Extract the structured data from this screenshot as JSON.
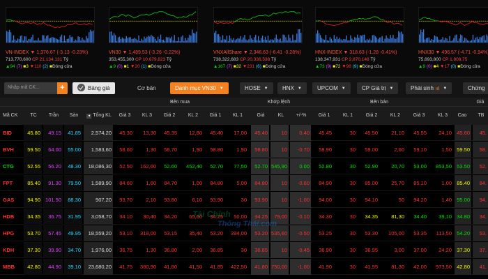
{
  "indices": [
    {
      "name": "VN-INDEX",
      "value": "1,376.67",
      "change": "(-3.13 -0.23%)",
      "vol": "713,770,600",
      "cp": "CP 21,134,131",
      "unit": "Tỷ",
      "up": "94",
      "ref": "(7)",
      "dn": "110",
      "ceil": "(2)",
      "floor": "3",
      "status": "Đóng cửa"
    },
    {
      "name": "VN30",
      "value": "1,489.53",
      "change": "(-3.26 -0.22%)",
      "vol": "353,455,300",
      "cp": "CP 10,679,823",
      "unit": "Tỷ",
      "up": "9",
      "ref": "(0)",
      "dn": "20",
      "ceil": "(1)",
      "floor": "1",
      "status": "Đóng cửa"
    },
    {
      "name": "VNXAllShare",
      "value": "2,346.63",
      "change": "(-6.41 -0.28%)",
      "vol": "738,322,683",
      "cp": "CP 20,336,538",
      "unit": "Tỷ",
      "up": "167",
      "ref": "(7)",
      "dn": "231",
      "ceil": "(6)",
      "floor": "32",
      "status": "Đóng cửa"
    },
    {
      "name": "HNX-INDEX",
      "value": "318.63",
      "change": "(-1.28 -0.41%)",
      "vol": "138,347,931",
      "cp": "CP 2,870,148",
      "unit": "Tỷ",
      "up": "73",
      "ref": "(9)",
      "dn": "98",
      "ceil": "(9)",
      "floor": "72",
      "status": "Đóng cửa"
    },
    {
      "name": "HNX30",
      "value": "496.57",
      "change": "(-4.71 -0.94%)",
      "vol": "75,693,800",
      "cp": "CP 1,808,75",
      "unit": "",
      "up": "9",
      "ref": "(0)",
      "dn": "17",
      "ceil": "(0)",
      "floor": "4",
      "status": "Đóng cửa"
    }
  ],
  "toolbar": {
    "search_placeholder": "Nhập mã CK...",
    "search_btn": "+",
    "bang_gia": "Bảng giá",
    "co_ban": "Cơ bản",
    "danh_muc": "Danh mục VN30",
    "hose": "HOSE",
    "hnx": "HNX",
    "upcom": "UPCOM",
    "cp_gia_tri": "CP Giá trị",
    "phai_sinh": "Phái sinh",
    "chung": "Chứng"
  },
  "headers": {
    "group_buy": "Bên mua",
    "group_match": "Khớp lệnh",
    "group_sell": "Bên bán",
    "group_more": "Giá",
    "ma_ck": "Mã CK",
    "tc": "TC",
    "tran": "Trần",
    "san": "Sàn",
    "tong_kl": "Tổng KL",
    "gia3": "Giá 3",
    "kl3": "KL 3",
    "gia2": "Giá 2",
    "kl2": "KL 2",
    "gia1": "Giá 1",
    "kl1": "KL 1",
    "gia": "Giá",
    "kl": "KL",
    "pm": "+/-%",
    "sgia1": "Giá 1",
    "skl1": "KL 1",
    "sgia2": "Giá 2",
    "skl2": "KL 2",
    "sgia3": "Giá 3",
    "skl3": "KL 3",
    "cao": "Cao",
    "tb": "TB"
  },
  "rows": [
    {
      "sym": "BID",
      "tc": "45.80",
      "tran": "49.15",
      "san": "41.85",
      "tong": "2,574,20",
      "b3": "45.30",
      "bk3": "13,30",
      "b2": "45.35",
      "bk2": "12,80",
      "b1": "45.40",
      "bk1": "17,00",
      "m": "45.40",
      "mk": "10",
      "pm": "0.40",
      "s1": "45.45",
      "sk1": "30",
      "s2": "45.50",
      "sk2": "21,10",
      "s3": "45.55",
      "sk3": "24,10",
      "cao": "45.60",
      "tb": "45."
    },
    {
      "sym": "BVH",
      "tc": "59.50",
      "tran": "64.00",
      "san": "55.00",
      "tong": "1,583,60",
      "b3": "58.60",
      "bk3": "1,30",
      "b2": "58.70",
      "bk2": "1,90",
      "b1": "58.80",
      "bk1": "1,90",
      "m": "58.80",
      "mk": "10",
      "pm": "-0.70",
      "s1": "58.90",
      "sk1": "30",
      "s2": "59.00",
      "sk2": "2,60",
      "s3": "59.10",
      "sk3": "1,50",
      "cao": "59.50",
      "tb": "58."
    },
    {
      "sym": "CTG",
      "tc": "52.55",
      "tran": "56.20",
      "san": "48.30",
      "tong": "18,086,30",
      "b3": "52.50",
      "bk3": "162,60",
      "b2": "52.60",
      "bk2": "452,40",
      "b1": "52.70",
      "bk1": "77,50",
      "m": "52.70",
      "mk": "545,90",
      "pm": "0.00",
      "s1": "52.80",
      "sk1": "30",
      "s2": "52.90",
      "sk2": "20,70",
      "s3": "53.00",
      "sk3": "853,50",
      "cao": "53.50",
      "tb": "52."
    },
    {
      "sym": "FPT",
      "tc": "85.40",
      "tran": "91.30",
      "san": "79.50",
      "tong": "1,589,90",
      "b3": "84.60",
      "bk3": "1,60",
      "b2": "84.70",
      "bk2": "1,00",
      "b1": "84.80",
      "bk1": "5,00",
      "m": "84.80",
      "mk": "10",
      "pm": "-0.60",
      "s1": "84.90",
      "sk1": "30",
      "s2": "85.00",
      "sk2": "25,70",
      "s3": "85.10",
      "sk3": "1,00",
      "cao": "85.40",
      "tb": "84."
    },
    {
      "sym": "GAS",
      "tc": "94.90",
      "tran": "101.50",
      "san": "88.30",
      "tong": "907,20",
      "b3": "93.70",
      "bk3": "2,10",
      "b2": "93.80",
      "bk2": "6,10",
      "b1": "93.90",
      "bk1": "30",
      "m": "93.90",
      "mk": "10",
      "pm": "-1.00",
      "s1": "94.00",
      "sk1": "30",
      "s2": "94.10",
      "sk2": "50",
      "s3": "94.20",
      "sk3": "1,40",
      "cao": "95.00",
      "tb": "94."
    },
    {
      "sym": "HDB",
      "tc": "34.35",
      "tran": "36.75",
      "san": "31.95",
      "tong": "3,058,70",
      "b3": "34.10",
      "bk3": "30,40",
      "b2": "34.20",
      "bk2": "65,60",
      "b1": "34.25",
      "bk1": "50,00",
      "m": "34.25",
      "mk": "79,00",
      "pm": "-0.10",
      "s1": "34.30",
      "sk1": "30",
      "s2": "34.35",
      "sk2": "81,30",
      "s3": "34.40",
      "sk3": "39,10",
      "cao": "34.80",
      "tb": "34."
    },
    {
      "sym": "HPG",
      "tc": "53.70",
      "tran": "57.45",
      "san": "49.95",
      "tong": "18,559,20",
      "b3": "53.10",
      "bk3": "318,00",
      "b2": "53.15",
      "bk2": "35,40",
      "b1": "53.20",
      "bk1": "394,00",
      "m": "53.20",
      "mk": "535,60",
      "pm": "-0.50",
      "s1": "53.25",
      "sk1": "30",
      "s2": "53.30",
      "sk2": "105,00",
      "s3": "53.35",
      "sk3": "113,50",
      "cao": "54.20",
      "tb": "53."
    },
    {
      "sym": "KDH",
      "tc": "37.30",
      "tran": "39.90",
      "san": "34.70",
      "tong": "1,976,00",
      "b3": "36.75",
      "bk3": "1,30",
      "b2": "36.80",
      "bk2": "2,00",
      "b1": "36.85",
      "bk1": "30",
      "m": "36.85",
      "mk": "10",
      "pm": "-0.45",
      "s1": "36.90",
      "sk1": "30",
      "s2": "36.95",
      "sk2": "3,00",
      "s3": "37.00",
      "sk3": "24,20",
      "cao": "37.30",
      "tb": "37."
    },
    {
      "sym": "MBB",
      "tc": "42.80",
      "tran": "44.90",
      "san": "39.10",
      "tong": "23,680,20",
      "b3": "41.75",
      "bk3": "380,90",
      "b2": "41.80",
      "bk2": "41,50",
      "b1": "41.85",
      "bk1": "422,50",
      "m": "41.80",
      "mk": "750,00",
      "pm": "-1.00",
      "s1": "41.90",
      "sk1": "30",
      "s2": "41.95",
      "sk2": "81,30",
      "s3": "42.00",
      "sk3": "973,50",
      "cao": "42.80",
      "tb": "41."
    }
  ]
}
